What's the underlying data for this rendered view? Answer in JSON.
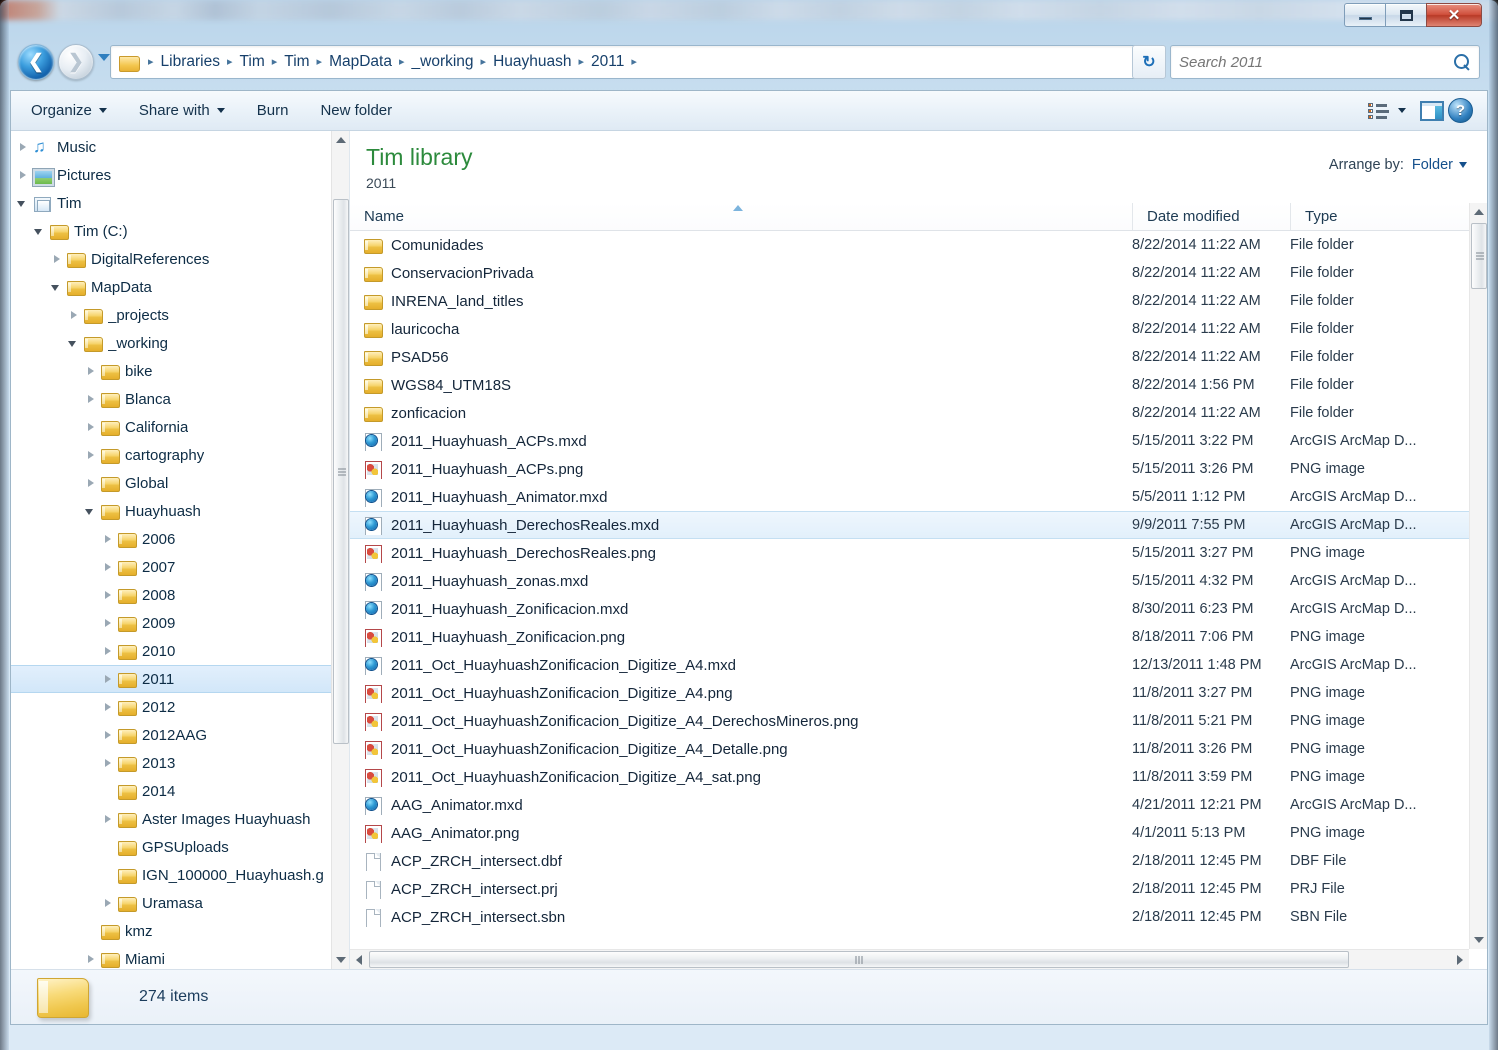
{
  "window": {
    "buttons": {
      "minimize": "–",
      "maximize": "□",
      "close": "✕"
    }
  },
  "navigation": {
    "back_label": "←",
    "forward_label": "→",
    "recent_pages_label": "Recent pages",
    "refresh_label": "↻",
    "breadcrumb": [
      "Libraries",
      "Tim",
      "Tim",
      "MapData",
      "_working",
      "Huayhuash",
      "2011"
    ],
    "breadcrumb_separator": "▸"
  },
  "search": {
    "placeholder": "Search 2011",
    "value": ""
  },
  "toolbar": {
    "items": [
      {
        "label": "Organize",
        "has_caret": true
      },
      {
        "label": "Share with",
        "has_caret": true
      },
      {
        "label": "Burn",
        "has_caret": false
      },
      {
        "label": "New folder",
        "has_caret": false
      }
    ],
    "view_icon": "list-view-icon",
    "view_caret": "chevron-down-icon",
    "preview_pane_icon": "preview-pane-icon",
    "help_icon": "help-icon",
    "help_glyph": "?"
  },
  "sidebar": {
    "items": [
      {
        "label": "Music",
        "indent": 0,
        "expander": "closed",
        "icon": "music"
      },
      {
        "label": "Pictures",
        "indent": 0,
        "expander": "closed",
        "icon": "pictures"
      },
      {
        "label": "Tim",
        "indent": 0,
        "expander": "open",
        "icon": "libuser"
      },
      {
        "label": "Tim (C:)",
        "indent": 1,
        "expander": "open",
        "icon": "folder"
      },
      {
        "label": "DigitalReferences",
        "indent": 2,
        "expander": "closed",
        "icon": "folder"
      },
      {
        "label": "MapData",
        "indent": 2,
        "expander": "open",
        "icon": "folder"
      },
      {
        "label": "_projects",
        "indent": 3,
        "expander": "closed",
        "icon": "folder"
      },
      {
        "label": "_working",
        "indent": 3,
        "expander": "open",
        "icon": "folder"
      },
      {
        "label": "bike",
        "indent": 4,
        "expander": "closed",
        "icon": "folder"
      },
      {
        "label": "Blanca",
        "indent": 4,
        "expander": "closed",
        "icon": "folder"
      },
      {
        "label": "California",
        "indent": 4,
        "expander": "closed",
        "icon": "folder"
      },
      {
        "label": "cartography",
        "indent": 4,
        "expander": "closed",
        "icon": "folder"
      },
      {
        "label": "Global",
        "indent": 4,
        "expander": "closed",
        "icon": "folder"
      },
      {
        "label": "Huayhuash",
        "indent": 4,
        "expander": "open",
        "icon": "folder"
      },
      {
        "label": "2006",
        "indent": 5,
        "expander": "closed",
        "icon": "folder"
      },
      {
        "label": "2007",
        "indent": 5,
        "expander": "closed",
        "icon": "folder"
      },
      {
        "label": "2008",
        "indent": 5,
        "expander": "closed",
        "icon": "folder"
      },
      {
        "label": "2009",
        "indent": 5,
        "expander": "closed",
        "icon": "folder"
      },
      {
        "label": "2010",
        "indent": 5,
        "expander": "closed",
        "icon": "folder"
      },
      {
        "label": "2011",
        "indent": 5,
        "expander": "closed",
        "icon": "folder",
        "selected": true
      },
      {
        "label": "2012",
        "indent": 5,
        "expander": "closed",
        "icon": "folder"
      },
      {
        "label": "2012AAG",
        "indent": 5,
        "expander": "closed",
        "icon": "folder"
      },
      {
        "label": "2013",
        "indent": 5,
        "expander": "closed",
        "icon": "folder"
      },
      {
        "label": "2014",
        "indent": 5,
        "expander": "none",
        "icon": "folder"
      },
      {
        "label": "Aster Images Huayhuash",
        "indent": 5,
        "expander": "closed",
        "icon": "folder"
      },
      {
        "label": "GPSUploads",
        "indent": 5,
        "expander": "none",
        "icon": "folder"
      },
      {
        "label": "IGN_100000_Huayhuash.g",
        "indent": 5,
        "expander": "none",
        "icon": "folder"
      },
      {
        "label": "Uramasa",
        "indent": 5,
        "expander": "closed",
        "icon": "folder"
      },
      {
        "label": "kmz",
        "indent": 4,
        "expander": "none",
        "icon": "folder"
      },
      {
        "label": "Miami",
        "indent": 4,
        "expander": "closed",
        "icon": "folder"
      }
    ]
  },
  "library": {
    "title": "Tim library",
    "subtitle": "2011",
    "arrange_label": "Arrange by:",
    "arrange_value": "Folder"
  },
  "columns": [
    {
      "key": "name",
      "label": "Name",
      "sorted": true,
      "sort_direction": "asc"
    },
    {
      "key": "date",
      "label": "Date modified"
    },
    {
      "key": "type",
      "label": "Type"
    }
  ],
  "files": [
    {
      "name": "Comunidades",
      "date": "8/22/2014 11:22 AM",
      "type": "File folder",
      "icon": "folder"
    },
    {
      "name": "ConservacionPrivada",
      "date": "8/22/2014 11:22 AM",
      "type": "File folder",
      "icon": "folder"
    },
    {
      "name": "INRENA_land_titles",
      "date": "8/22/2014 11:22 AM",
      "type": "File folder",
      "icon": "folder"
    },
    {
      "name": "lauricocha",
      "date": "8/22/2014 11:22 AM",
      "type": "File folder",
      "icon": "folder"
    },
    {
      "name": "PSAD56",
      "date": "8/22/2014 11:22 AM",
      "type": "File folder",
      "icon": "folder"
    },
    {
      "name": "WGS84_UTM18S",
      "date": "8/22/2014 1:56 PM",
      "type": "File folder",
      "icon": "folder"
    },
    {
      "name": "zonficacion",
      "date": "8/22/2014 11:22 AM",
      "type": "File folder",
      "icon": "folder"
    },
    {
      "name": "2011_Huayhuash_ACPs.mxd",
      "date": "5/15/2011 3:22 PM",
      "type": "ArcGIS ArcMap D...",
      "icon": "mxd"
    },
    {
      "name": "2011_Huayhuash_ACPs.png",
      "date": "5/15/2011 3:26 PM",
      "type": "PNG image",
      "icon": "png"
    },
    {
      "name": "2011_Huayhuash_Animator.mxd",
      "date": "5/5/2011 1:12 PM",
      "type": "ArcGIS ArcMap D...",
      "icon": "mxd"
    },
    {
      "name": "2011_Huayhuash_DerechosReales.mxd",
      "date": "9/9/2011 7:55 PM",
      "type": "ArcGIS ArcMap D...",
      "icon": "mxd",
      "selected": true
    },
    {
      "name": "2011_Huayhuash_DerechosReales.png",
      "date": "5/15/2011 3:27 PM",
      "type": "PNG image",
      "icon": "png"
    },
    {
      "name": "2011_Huayhuash_zonas.mxd",
      "date": "5/15/2011 4:32 PM",
      "type": "ArcGIS ArcMap D...",
      "icon": "mxd"
    },
    {
      "name": "2011_Huayhuash_Zonificacion.mxd",
      "date": "8/30/2011 6:23 PM",
      "type": "ArcGIS ArcMap D...",
      "icon": "mxd"
    },
    {
      "name": "2011_Huayhuash_Zonificacion.png",
      "date": "8/18/2011 7:06 PM",
      "type": "PNG image",
      "icon": "png"
    },
    {
      "name": "2011_Oct_HuayhuashZonificacion_Digitize_A4.mxd",
      "date": "12/13/2011 1:48 PM",
      "type": "ArcGIS ArcMap D...",
      "icon": "mxd"
    },
    {
      "name": "2011_Oct_HuayhuashZonificacion_Digitize_A4.png",
      "date": "11/8/2011 3:27 PM",
      "type": "PNG image",
      "icon": "png"
    },
    {
      "name": "2011_Oct_HuayhuashZonificacion_Digitize_A4_DerechosMineros.png",
      "date": "11/8/2011 5:21 PM",
      "type": "PNG image",
      "icon": "png"
    },
    {
      "name": "2011_Oct_HuayhuashZonificacion_Digitize_A4_Detalle.png",
      "date": "11/8/2011 3:26 PM",
      "type": "PNG image",
      "icon": "png"
    },
    {
      "name": "2011_Oct_HuayhuashZonificacion_Digitize_A4_sat.png",
      "date": "11/8/2011 3:59 PM",
      "type": "PNG image",
      "icon": "png"
    },
    {
      "name": "AAG_Animator.mxd",
      "date": "4/21/2011 12:21 PM",
      "type": "ArcGIS ArcMap D...",
      "icon": "mxd"
    },
    {
      "name": "AAG_Animator.png",
      "date": "4/1/2011 5:13 PM",
      "type": "PNG image",
      "icon": "png"
    },
    {
      "name": "ACP_ZRCH_intersect.dbf",
      "date": "2/18/2011 12:45 PM",
      "type": "DBF File",
      "icon": "doc"
    },
    {
      "name": "ACP_ZRCH_intersect.prj",
      "date": "2/18/2011 12:45 PM",
      "type": "PRJ File",
      "icon": "doc"
    },
    {
      "name": "ACP_ZRCH_intersect.sbn",
      "date": "2/18/2011 12:45 PM",
      "type": "SBN File",
      "icon": "doc"
    }
  ],
  "status": {
    "item_count": "274 items",
    "icon": "folder-icon"
  },
  "colors": {
    "accent": "#2f7fbf",
    "library_title": "#2c8a3c",
    "link": "#15508c",
    "selection": "#d2e7f9",
    "close_button": "#d0503c"
  }
}
